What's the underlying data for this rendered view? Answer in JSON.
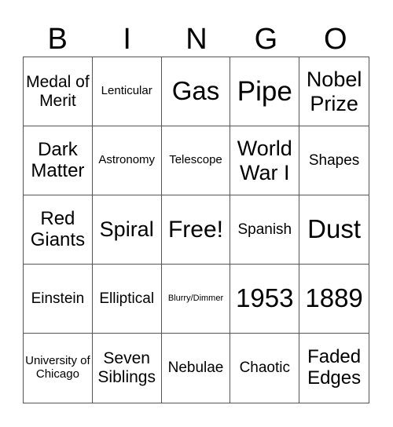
{
  "header": [
    "B",
    "I",
    "N",
    "G",
    "O"
  ],
  "cells": [
    "Medal of Merit",
    "Lenticular",
    "Gas",
    "Pipe",
    "Nobel Prize",
    "Dark Matter",
    "Astronomy",
    "Telescope",
    "World War I",
    "Shapes",
    "Red Giants",
    "Spiral",
    "Free!",
    "Spanish",
    "Dust",
    "Einstein",
    "Elliptical",
    "Blurry/Dimmer",
    "1953",
    "1889",
    "University of Chicago",
    "Seven Siblings",
    "Nebulae",
    "Chaotic",
    "Faded Edges"
  ]
}
